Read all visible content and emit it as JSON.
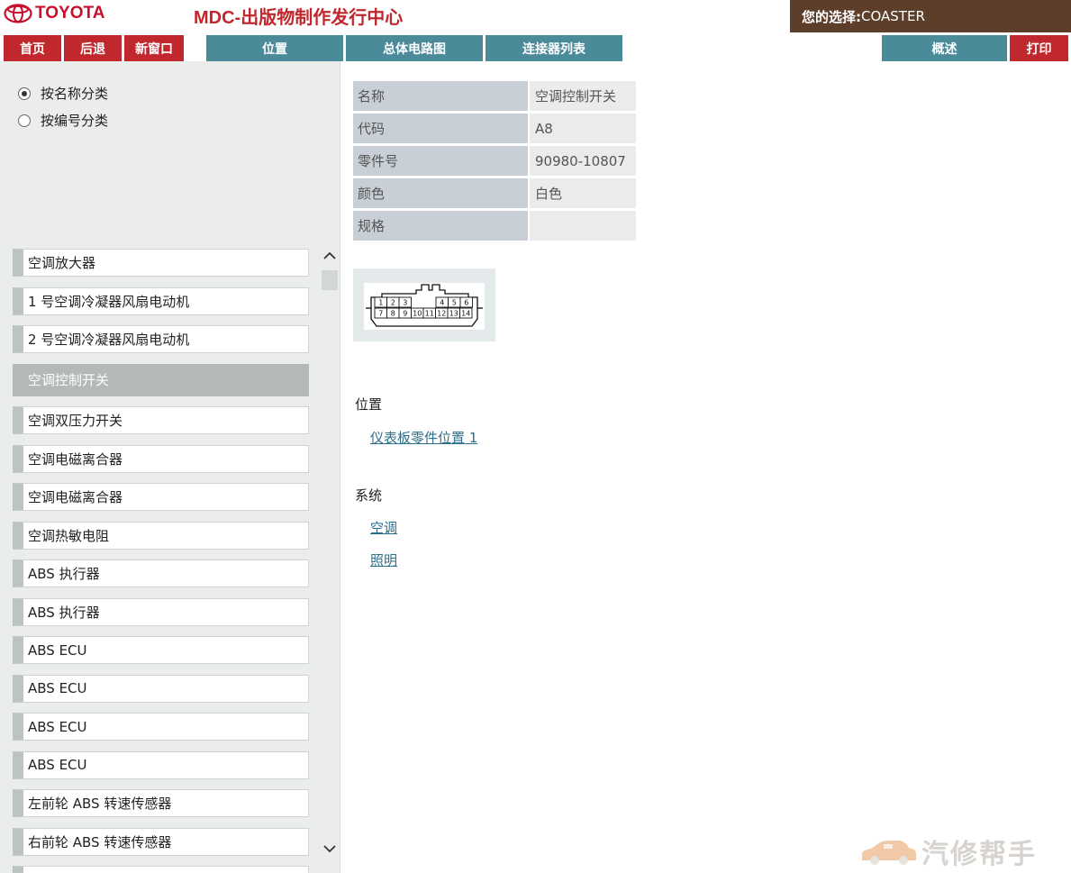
{
  "header": {
    "logo_text": "TOYOTA",
    "app_title": "MDC-出版物制作发行中心",
    "selection_label": "您的选择:",
    "selection_value": "COASTER"
  },
  "toolbar": {
    "home": "首页",
    "back": "后退",
    "new_window": "新窗口",
    "location": "位置",
    "overall_wiring": "总体电路图",
    "connector_list": "连接器列表",
    "overview": "概述",
    "print": "打印"
  },
  "sort_options": [
    {
      "label": "按名称分类",
      "checked": true
    },
    {
      "label": "按编号分类",
      "checked": false
    }
  ],
  "component_list": [
    "空调放大器",
    "1 号空调冷凝器风扇电动机",
    "2 号空调冷凝器风扇电动机",
    "空调控制开关",
    "空调双压力开关",
    "空调电磁离合器",
    "空调电磁离合器",
    "空调热敏电阻",
    "ABS 执行器",
    "ABS 执行器",
    "ABS ECU",
    "ABS ECU",
    "ABS ECU",
    "ABS ECU",
    "左前轮 ABS 转速传感器",
    "右前轮 ABS 转速传感器"
  ],
  "selected_index": 3,
  "details": {
    "name_label": "名称",
    "name_value": "空调控制开关",
    "code_label": "代码",
    "code_value": "A8",
    "part_label": "零件号",
    "part_value": "90980-10807",
    "color_label": "颜色",
    "color_value": "白色",
    "spec_label": "规格",
    "spec_value": ""
  },
  "connector_pins": {
    "top_left": [
      "1",
      "2",
      "3"
    ],
    "top_right": [
      "4",
      "5",
      "6"
    ],
    "bottom": [
      "7",
      "8",
      "9",
      "10",
      "11",
      "12",
      "13",
      "14"
    ]
  },
  "location": {
    "heading": "位置",
    "link": "仪表板零件位置 1"
  },
  "system": {
    "heading": "系统",
    "links": [
      "空调",
      "照明"
    ]
  },
  "watermark": {
    "text": "汽修帮手"
  },
  "colors": {
    "brand_red": "#c0282e",
    "toolbar_teal": "#4a8a99",
    "selection_brown": "#5c3e2a",
    "link_blue": "#2c6f8a"
  }
}
